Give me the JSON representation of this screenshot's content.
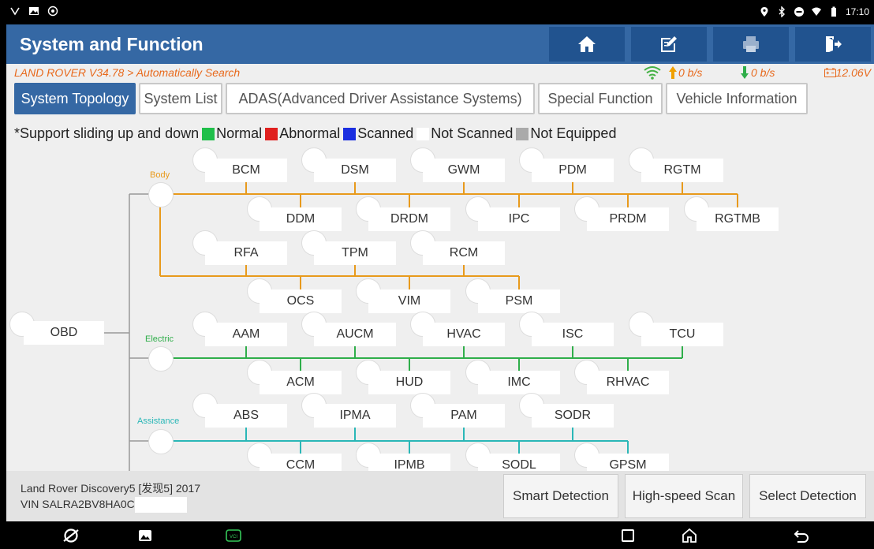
{
  "status_bar": {
    "clock": "17:10",
    "icons": [
      "signal-icon",
      "image-icon",
      "settings-icon",
      "location-icon",
      "bluetooth-icon",
      "dnd-icon",
      "wifi-icon",
      "battery-icon"
    ]
  },
  "header": {
    "title": "System and Function",
    "buttons": [
      "home-icon",
      "edit-icon",
      "print-icon",
      "exit-icon"
    ]
  },
  "info": {
    "path": "LAND ROVER V34.78 > Automatically Search",
    "upload_rate": "0 b/s",
    "download_rate": "0 b/s",
    "voltage": "12.06V",
    "colors": {
      "accent": "#e8691c",
      "wifi": "#45b245"
    }
  },
  "tabs": [
    {
      "label": "System Topology",
      "active": true
    },
    {
      "label": "System List",
      "active": false
    },
    {
      "label": "ADAS(Advanced Driver Assistance Systems)",
      "active": false
    },
    {
      "label": "Special Function",
      "active": false
    },
    {
      "label": "Vehicle Information",
      "active": false
    }
  ],
  "legend": {
    "note": "*Support sliding up and down",
    "items": [
      {
        "label": "Normal",
        "color": "#1fbf4a"
      },
      {
        "label": "Abnormal",
        "color": "#e0201e"
      },
      {
        "label": "Scanned",
        "color": "#1a2ee0"
      },
      {
        "label": "Not Scanned",
        "color": "#ffffff"
      },
      {
        "label": "Not Equipped",
        "color": "#aaaaaa"
      }
    ]
  },
  "topology": {
    "root": "OBD",
    "groups": [
      {
        "name": "Body",
        "color": "#e89a1c",
        "modules": [
          "BCM",
          "DSM",
          "GWM",
          "PDM",
          "RGTM",
          "DDM",
          "DRDM",
          "IPC",
          "PRDM",
          "RGTMB",
          "RFA",
          "TPM",
          "RCM",
          "OCS",
          "VIM",
          "PSM"
        ]
      },
      {
        "name": "Electric",
        "color": "#2fae4a",
        "modules": [
          "AAM",
          "AUCM",
          "HVAC",
          "ISC",
          "TCU",
          "ACM",
          "HUD",
          "IMC",
          "RHVAC"
        ]
      },
      {
        "name": "Assistance",
        "color": "#2ab7b7",
        "modules": [
          "ABS",
          "IPMA",
          "PAM",
          "SODR",
          "CCM",
          "IPMB",
          "SODL",
          "GPSM"
        ]
      }
    ]
  },
  "footer": {
    "vehicle_line": "Land Rover Discovery5 [发现5] 2017",
    "vin_line": "VIN SALRA2BV8HA0C",
    "buttons": [
      "Smart Detection",
      "High-speed Scan",
      "Select Detection"
    ]
  },
  "navbar": {
    "icons": [
      "browser-icon",
      "gallery-icon",
      "vci-icon",
      "recent-apps-icon",
      "home-nav-icon",
      "back-icon"
    ]
  }
}
